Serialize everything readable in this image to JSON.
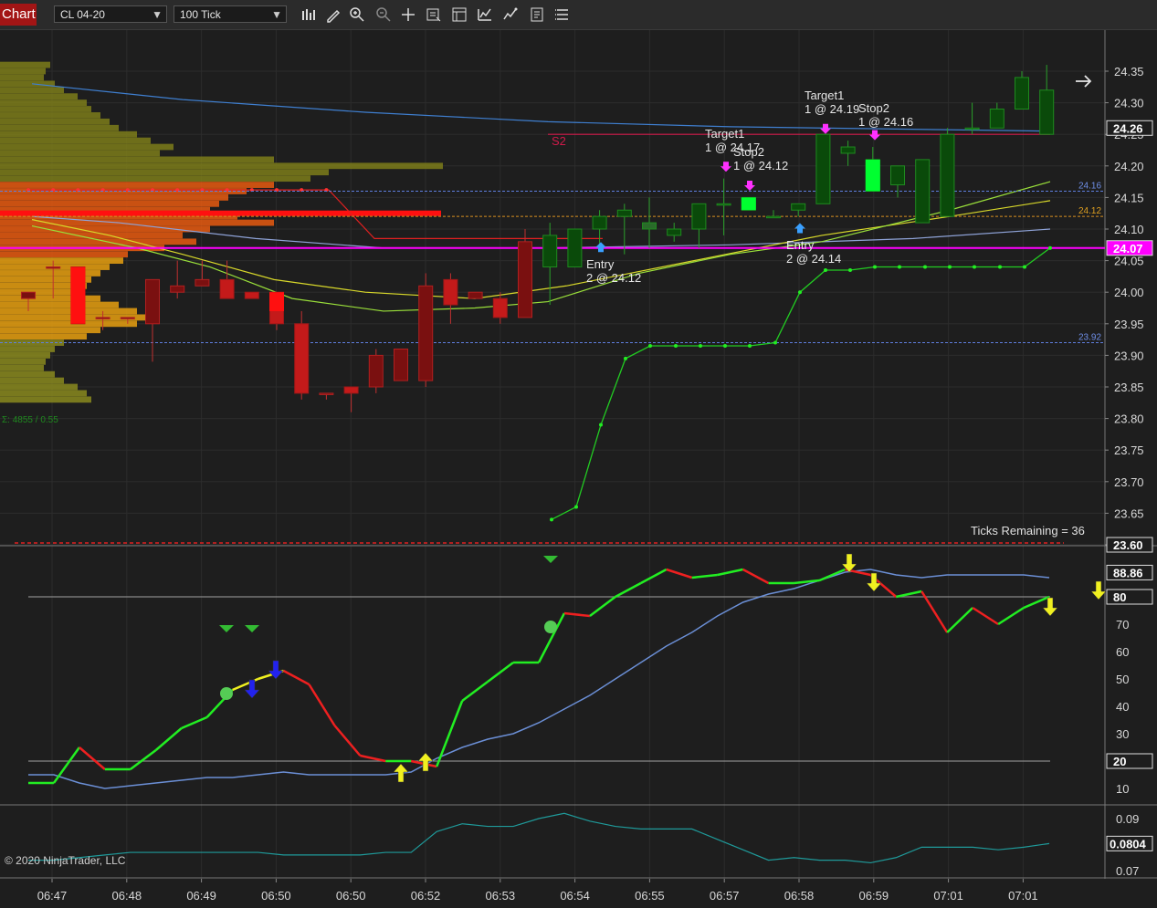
{
  "toolbar": {
    "tab_label": "Chart",
    "instrument": "CL 04-20",
    "period": "100 Tick",
    "icons": [
      "bar-type-icon",
      "draw-pencil-icon",
      "zoom-in-icon",
      "zoom-out-icon",
      "crosshair-icon",
      "properties-icon",
      "data-box-icon",
      "indicators-icon",
      "strategies-icon",
      "templates-icon",
      "menu-icon"
    ]
  },
  "colors": {
    "background": "#1e1e1e",
    "up": "#1f8f1f",
    "down": "#b01c1c",
    "magenta": "#ff00ff",
    "stoch_k": "#22dd22",
    "stoch_d": "#6b8fd6"
  },
  "price_axis": {
    "ticks": [
      "24.35",
      "24.30",
      "24.25",
      "24.20",
      "24.15",
      "24.10",
      "24.05",
      "24.00",
      "23.95",
      "23.90",
      "23.85",
      "23.80",
      "23.75",
      "23.70",
      "23.65",
      "23.60"
    ],
    "current_price": "24.07",
    "tags": [
      {
        "text": "24.26",
        "color": "#ffffff",
        "bg": "#1e1e1e"
      },
      {
        "text": "24.07",
        "color": "#ffffff",
        "bg": "#ff00ff"
      },
      {
        "text": "23.60",
        "color": "#ffffff",
        "bg": "#1e1e1e"
      }
    ],
    "level_labels": [
      {
        "text": "24.16",
        "color": "#6f8fe8"
      },
      {
        "text": "24.12",
        "color": "#e0a020"
      },
      {
        "text": "23.92",
        "color": "#6f8fe8"
      }
    ]
  },
  "annotations": {
    "s2": "S2",
    "entry1": [
      "Entry",
      "2 @ 24.12"
    ],
    "target1_a": [
      "Target1",
      "1 @ 24.17"
    ],
    "stop2_a": [
      "Stop2",
      "1 @ 24.12"
    ],
    "target1_b": [
      "Target1",
      "1 @ 24.19"
    ],
    "stop2_b": [
      "Stop2",
      "1 @ 24.16"
    ],
    "entry2": [
      "Entry",
      "2 @ 24.14"
    ],
    "ticks_remaining": "Ticks Remaining = 36",
    "volume_summary": "Σ: 4855 / 0.55"
  },
  "stoch_axis": {
    "ticks": [
      "90",
      "80",
      "70",
      "60",
      "50",
      "40",
      "30",
      "20",
      "10"
    ],
    "tags": [
      {
        "text": "88.86"
      },
      {
        "text": "80"
      },
      {
        "text": "20"
      }
    ]
  },
  "osc_axis": {
    "ticks": [
      "0.09",
      "0.07"
    ],
    "tag": "0.0804"
  },
  "time_axis": [
    "06:47",
    "06:48",
    "06:49",
    "06:50",
    "06:50",
    "06:52",
    "06:53",
    "06:54",
    "06:55",
    "06:57",
    "06:58",
    "06:59",
    "07:01",
    "07:01"
  ],
  "copyright": "© 2020 NinjaTrader, LLC",
  "chart_data": [
    {
      "type": "candlestick",
      "title": "CL 04-20 100 Tick",
      "candles": [
        {
          "o": 23.99,
          "h": 24.0,
          "l": 23.97,
          "c": 24.0
        },
        {
          "o": 24.04,
          "h": 24.05,
          "l": 23.99,
          "c": 24.04
        },
        {
          "o": 24.04,
          "h": 24.04,
          "l": 23.95,
          "c": 23.95
        },
        {
          "o": 23.96,
          "h": 23.97,
          "l": 23.94,
          "c": 23.96
        },
        {
          "o": 23.96,
          "h": 23.96,
          "l": 23.95,
          "c": 23.96
        },
        {
          "o": 23.95,
          "h": 24.02,
          "l": 23.89,
          "c": 24.02
        },
        {
          "o": 24.0,
          "h": 24.05,
          "l": 23.99,
          "c": 24.01
        },
        {
          "o": 24.01,
          "h": 24.05,
          "l": 24.01,
          "c": 24.02
        },
        {
          "o": 24.02,
          "h": 24.05,
          "l": 23.99,
          "c": 23.99
        },
        {
          "o": 24.0,
          "h": 24.0,
          "l": 23.99,
          "c": 23.99
        },
        {
          "o": 24.0,
          "h": 24.0,
          "l": 23.94,
          "c": 23.95
        },
        {
          "o": 23.95,
          "h": 23.97,
          "l": 23.83,
          "c": 23.84
        },
        {
          "o": 23.84,
          "h": 23.84,
          "l": 23.83,
          "c": 23.84
        },
        {
          "o": 23.85,
          "h": 23.85,
          "l": 23.81,
          "c": 23.84
        },
        {
          "o": 23.85,
          "h": 23.91,
          "l": 23.84,
          "c": 23.9
        },
        {
          "o": 23.86,
          "h": 23.91,
          "l": 23.86,
          "c": 23.91
        },
        {
          "o": 23.86,
          "h": 24.03,
          "l": 23.85,
          "c": 24.01
        },
        {
          "o": 24.02,
          "h": 24.03,
          "l": 23.95,
          "c": 23.98
        },
        {
          "o": 23.99,
          "h": 24.0,
          "l": 23.99,
          "c": 24.0
        },
        {
          "o": 23.99,
          "h": 24.0,
          "l": 23.95,
          "c": 23.96
        },
        {
          "o": 23.96,
          "h": 24.1,
          "l": 23.96,
          "c": 24.08
        },
        {
          "o": 24.04,
          "h": 24.11,
          "l": 23.98,
          "c": 24.09
        },
        {
          "o": 24.04,
          "h": 24.1,
          "l": 24.04,
          "c": 24.1
        },
        {
          "o": 24.1,
          "h": 24.13,
          "l": 24.07,
          "c": 24.12
        },
        {
          "o": 24.12,
          "h": 24.14,
          "l": 24.06,
          "c": 24.13
        },
        {
          "o": 24.11,
          "h": 24.15,
          "l": 24.07,
          "c": 24.1
        },
        {
          "o": 24.09,
          "h": 24.11,
          "l": 24.08,
          "c": 24.1
        },
        {
          "o": 24.1,
          "h": 24.14,
          "l": 24.07,
          "c": 24.14
        },
        {
          "o": 24.14,
          "h": 24.18,
          "l": 24.09,
          "c": 24.14
        },
        {
          "o": 24.15,
          "h": 24.15,
          "l": 24.13,
          "c": 24.13
        },
        {
          "o": 24.12,
          "h": 24.13,
          "l": 24.12,
          "c": 24.12
        },
        {
          "o": 24.13,
          "h": 24.14,
          "l": 24.12,
          "c": 24.14
        },
        {
          "o": 24.14,
          "h": 24.25,
          "l": 24.14,
          "c": 24.25
        },
        {
          "o": 24.22,
          "h": 24.24,
          "l": 24.2,
          "c": 24.23
        },
        {
          "o": 24.21,
          "h": 24.23,
          "l": 24.16,
          "c": 24.16
        },
        {
          "o": 24.17,
          "h": 24.2,
          "l": 24.15,
          "c": 24.2
        },
        {
          "o": 24.11,
          "h": 24.21,
          "l": 24.11,
          "c": 24.21
        },
        {
          "o": 24.12,
          "h": 24.26,
          "l": 24.12,
          "c": 24.25
        },
        {
          "o": 24.26,
          "h": 24.3,
          "l": 24.25,
          "c": 24.26
        },
        {
          "o": 24.26,
          "h": 24.3,
          "l": 24.26,
          "c": 24.29
        },
        {
          "o": 24.29,
          "h": 24.35,
          "l": 24.29,
          "c": 24.34
        },
        {
          "o": 24.25,
          "h": 24.36,
          "l": 24.25,
          "c": 24.32
        }
      ],
      "ylim": [
        23.6,
        24.37
      ]
    },
    {
      "type": "line",
      "title": "Stochastics",
      "ylim": [
        0,
        100
      ],
      "series": [
        {
          "values": [
            12,
            12,
            25,
            17,
            17,
            24,
            32,
            36,
            46,
            50,
            53,
            48,
            33,
            22,
            20,
            20,
            18,
            42,
            49,
            56,
            56,
            74,
            73,
            80,
            85,
            90,
            87,
            88,
            90,
            85,
            85,
            86,
            90,
            88,
            80,
            82,
            67,
            76,
            70,
            76,
            80
          ]
        },
        {
          "values": [
            15,
            15,
            12,
            10,
            11,
            12,
            13,
            14,
            14,
            15,
            16,
            15,
            15,
            15,
            15,
            16,
            21,
            25,
            28,
            30,
            34,
            39,
            44,
            50,
            56,
            62,
            67,
            73,
            78,
            81,
            83,
            86,
            89,
            90,
            88,
            87,
            88,
            88,
            88,
            88,
            87
          ]
        }
      ],
      "levels": [
        20,
        80
      ]
    },
    {
      "type": "line",
      "title": "Oscillator",
      "ylim": [
        0.07,
        0.095
      ],
      "series": [
        {
          "values": [
            0.074,
            0.074,
            0.075,
            0.076,
            0.077,
            0.077,
            0.077,
            0.077,
            0.077,
            0.077,
            0.076,
            0.076,
            0.076,
            0.076,
            0.077,
            0.077,
            0.085,
            0.088,
            0.087,
            0.087,
            0.09,
            0.092,
            0.089,
            0.087,
            0.086,
            0.086,
            0.086,
            0.082,
            0.078,
            0.074,
            0.075,
            0.074,
            0.074,
            0.073,
            0.075,
            0.079,
            0.079,
            0.079,
            0.078,
            0.079,
            0.0804
          ]
        }
      ]
    }
  ]
}
